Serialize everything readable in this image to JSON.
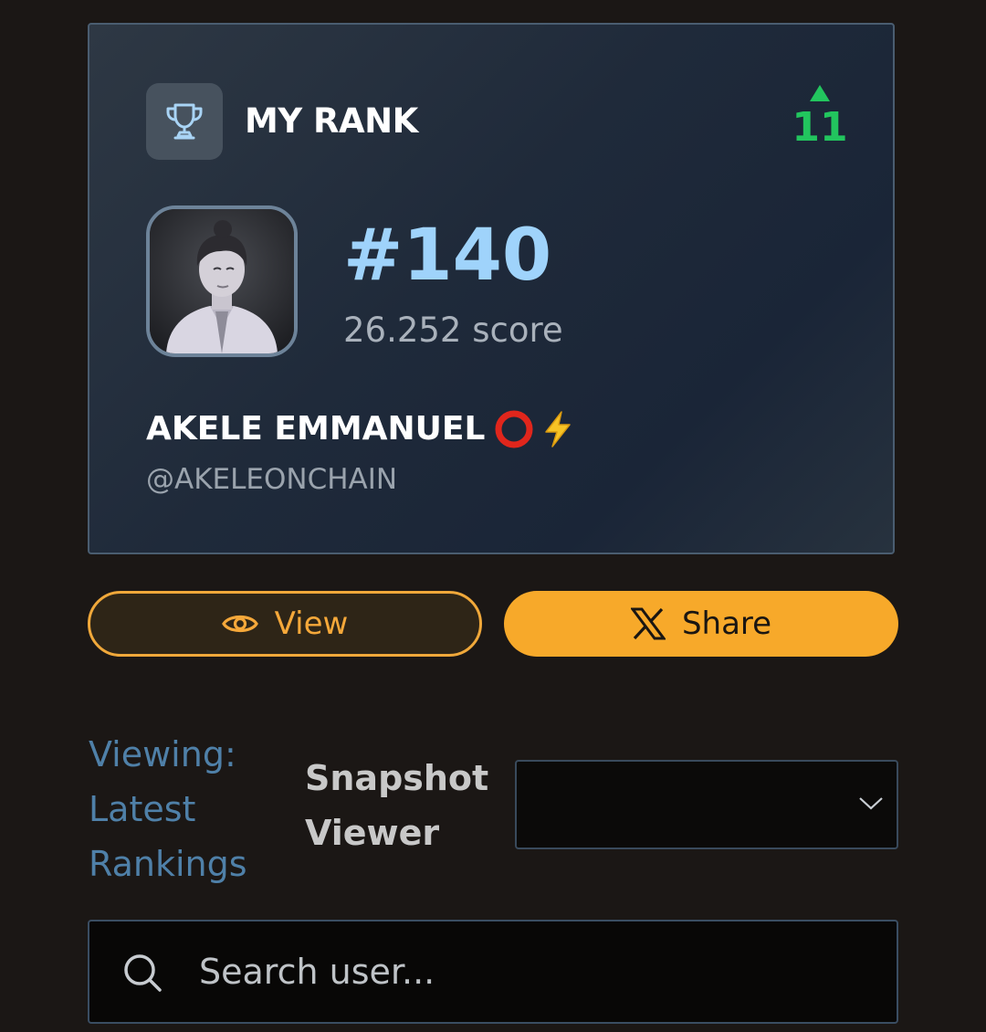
{
  "rank_card": {
    "title": "MY RANK",
    "rank_change": "11",
    "rank_change_direction": "up",
    "rank": "#140",
    "score": "26.252 score",
    "display_name": "AKELE EMMANUEL",
    "name_badges": [
      "red-ring-icon",
      "lightning-icon"
    ],
    "handle": "@AKELEONCHAIN",
    "icons": {
      "title": "trophy-icon",
      "avatar": "user-avatar"
    }
  },
  "actions": {
    "view_label": "View",
    "view_icon": "eye-icon",
    "share_label": "Share",
    "share_icon": "x-logo-icon"
  },
  "snapshot": {
    "viewing_text": "Viewing: Latest Rankings",
    "label": "Snapshot Viewer",
    "selected_value": "",
    "dropdown_icon": "chevron-down-icon"
  },
  "search": {
    "placeholder": "Search user...",
    "value": "",
    "icon": "search-icon"
  },
  "colors": {
    "page_bg": "#1b1715",
    "accent_orange": "#f7a92a",
    "rank_blue": "#9fd3fb",
    "positive_green": "#22c55e",
    "link_blue": "#4f80a8"
  }
}
